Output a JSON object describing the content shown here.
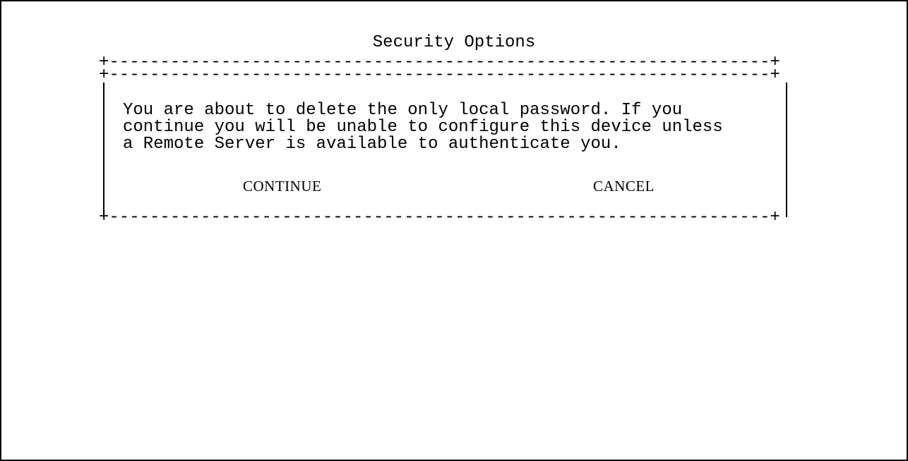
{
  "dialog": {
    "title": "Security Options",
    "rule_top": "+-----------------------------------------------------------------+",
    "rule_top2": "+-----------------------------------------------------------------+",
    "rule_bottom": "+-----------------------------------------------------------------+",
    "message": "You are about to delete the only local password. If you\ncontinue you will be unable to configure this device unless\na Remote Server is available to authenticate you.",
    "continue_label": "CONTINUE",
    "cancel_label": "CANCEL"
  },
  "colors": {
    "background": "#ffffff",
    "foreground": "#000000"
  }
}
